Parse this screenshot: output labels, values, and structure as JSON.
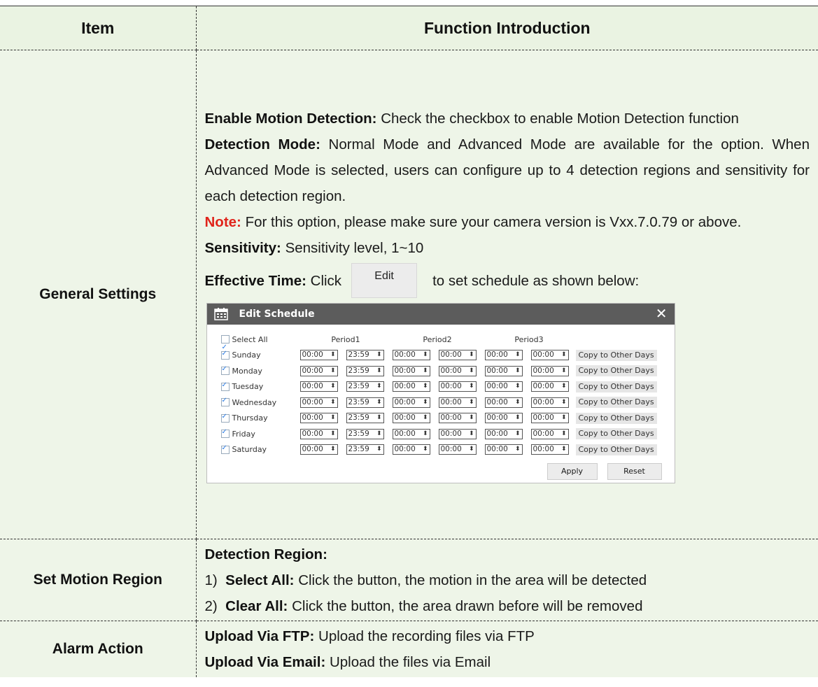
{
  "table": {
    "headers": {
      "item": "Item",
      "function": "Function Introduction"
    },
    "rows": [
      {
        "item": "General Settings",
        "entries": [
          {
            "label": "Enable Motion Detection:",
            "text": " Check the checkbox to enable Motion Detection function"
          },
          {
            "label": "Detection Mode:",
            "text": " Normal Mode and Advanced Mode are available for the option. When Advanced Mode is selected, users can configure up to 4 detection regions and sensitivity for each detection region."
          },
          {
            "label": "Note:",
            "text": " For this option, please make sure your camera version is Vxx.7.0.79 or above."
          },
          {
            "label": "Sensitivity:",
            "text": " Sensitivity level, 1~10"
          },
          {
            "label": "Effective Time:",
            "text_before": " Click",
            "button": "Edit",
            "text_after": "to set schedule as shown below:"
          }
        ]
      },
      {
        "item": "Set Motion Region",
        "heading": "Detection Region:",
        "list": [
          {
            "num": "1)",
            "label": "Select All:",
            "text": " Click the button, the motion in the area will be detected"
          },
          {
            "num": "2)",
            "label": "Clear All:",
            "text": " Click the button, the area drawn before will be removed"
          }
        ]
      },
      {
        "item": "Alarm Action",
        "entries": [
          {
            "label": "Upload Via FTP:",
            "text": " Upload the recording files via FTP"
          },
          {
            "label": "Upload Via Email:",
            "text": " Upload the files via Email"
          }
        ]
      }
    ]
  },
  "schedule_dialog": {
    "title": "Edit Schedule",
    "close_glyph": "✕",
    "icon": "calendar-icon",
    "select_all": "Select All",
    "periods": [
      "Period1",
      "Period2",
      "Period3"
    ],
    "days": [
      {
        "name": "Sunday",
        "times": [
          "00:00",
          "23:59",
          "00:00",
          "00:00",
          "00:00",
          "00:00"
        ]
      },
      {
        "name": "Monday",
        "times": [
          "00:00",
          "23:59",
          "00:00",
          "00:00",
          "00:00",
          "00:00"
        ]
      },
      {
        "name": "Tuesday",
        "times": [
          "00:00",
          "23:59",
          "00:00",
          "00:00",
          "00:00",
          "00:00"
        ]
      },
      {
        "name": "Wednesday",
        "times": [
          "00:00",
          "23:59",
          "00:00",
          "00:00",
          "00:00",
          "00:00"
        ]
      },
      {
        "name": "Thursday",
        "times": [
          "00:00",
          "23:59",
          "00:00",
          "00:00",
          "00:00",
          "00:00"
        ]
      },
      {
        "name": "Friday",
        "times": [
          "00:00",
          "23:59",
          "00:00",
          "00:00",
          "00:00",
          "00:00"
        ]
      },
      {
        "name": "Saturday",
        "times": [
          "00:00",
          "23:59",
          "00:00",
          "00:00",
          "00:00",
          "00:00"
        ]
      }
    ],
    "copy_label": "Copy to Other Days",
    "spinner_glyph": "⬍",
    "apply_label": "Apply",
    "reset_label": "Reset"
  },
  "colors": {
    "row_bg": "#eef5e8",
    "note_red": "#e0241b",
    "checkbox_blue": "#2a7be4",
    "dialog_title_bg": "#5c5c5c"
  }
}
